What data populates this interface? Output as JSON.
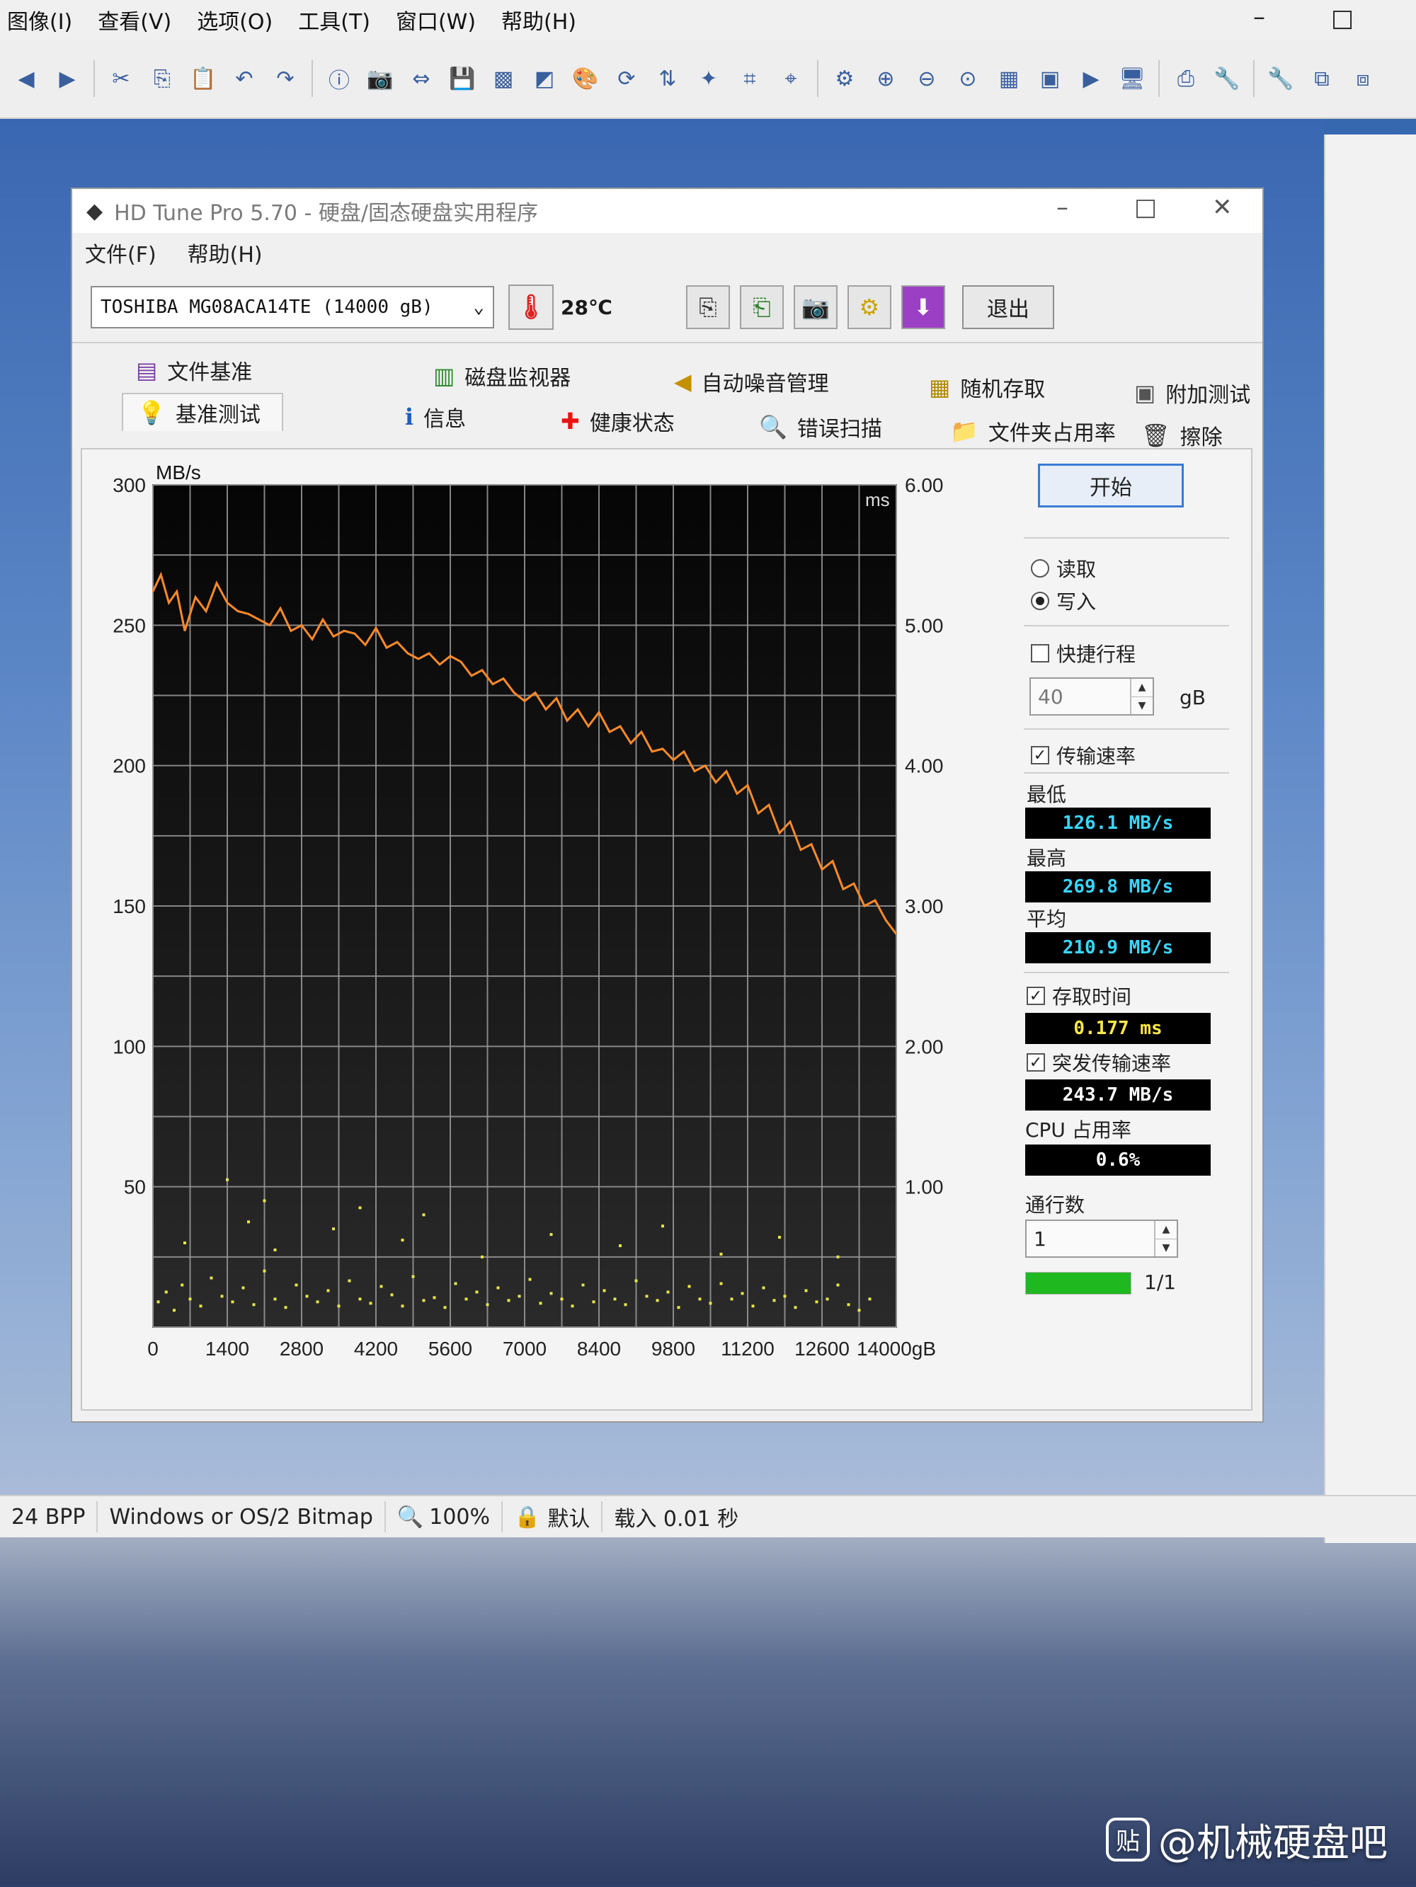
{
  "viewer": {
    "menu": [
      "图像(I)",
      "查看(V)",
      "选项(O)",
      "工具(T)",
      "窗口(W)",
      "帮助(H)"
    ],
    "window_controls": {
      "minimize": "–",
      "maximize": "□"
    },
    "status": {
      "bpp": "24 BPP",
      "format": "Windows or OS/2 Bitmap",
      "zoom": "100%",
      "profile": "默认",
      "load_time": "载入 0.01 秒"
    },
    "toolbar_icons": [
      "back-icon",
      "forward-icon",
      "cut-icon",
      "copy-icon",
      "paste-icon",
      "undo-icon",
      "redo-icon",
      "info-icon",
      "camera-icon",
      "resize-icon",
      "save-icon",
      "grayscale-icon",
      "color-icon",
      "palette-icon",
      "rotate-icon",
      "flip-icon",
      "effects-icon",
      "crop-icon",
      "crop-select-icon",
      "settings-icon",
      "zoom-in-icon",
      "zoom-out-icon",
      "zoom-fit-icon",
      "gallery-icon",
      "thumbnail-icon",
      "slideshow-icon",
      "screen-icon",
      "capture-icon",
      "tools-icon",
      "wrench-icon",
      "copy-to-icon",
      "move-to-icon"
    ]
  },
  "watermark": "@机械硬盘吧",
  "app": {
    "title": "HD Tune Pro 5.70 - 硬盘/固态硬盘实用程序",
    "menu": [
      "文件(F)",
      "帮助(H)"
    ],
    "window_controls": {
      "minimize": "–",
      "maximize": "□",
      "close": "✕"
    },
    "drive": "TOSHIBA MG08ACA14TE (14000 gB)",
    "temperature": "28℃",
    "exit_label": "退出",
    "tabs_row1": [
      "文件基准",
      "磁盘监视器",
      "自动噪音管理",
      "随机存取",
      "附加测试"
    ],
    "tabs_row2": [
      "基准测试",
      "信息",
      "健康状态",
      "错误扫描",
      "文件夹占用率",
      "擦除"
    ]
  },
  "controls": {
    "start": "开始",
    "read": "读取",
    "write": "写入",
    "mode_selected": "write",
    "short_stroke": {
      "label": "快捷行程",
      "checked": false,
      "value": "40",
      "unit": "gB"
    },
    "transfer_rate": {
      "label": "传输速率",
      "checked": true
    },
    "min": {
      "label": "最低",
      "value": "126.1 MB/s"
    },
    "max": {
      "label": "最高",
      "value": "269.8 MB/s"
    },
    "avg": {
      "label": "平均",
      "value": "210.9 MB/s"
    },
    "access_time": {
      "label": "存取时间",
      "checked": true,
      "value": "0.177 ms"
    },
    "burst_rate": {
      "label": "突发传输速率",
      "checked": true,
      "value": "243.7 MB/s"
    },
    "cpu": {
      "label": "CPU 占用率",
      "value": "0.6%"
    },
    "passes": {
      "label": "通行数",
      "value": "1"
    },
    "progress": {
      "fraction": 1.0,
      "text": "1/1"
    }
  },
  "chart_data": {
    "type": "line",
    "left_unit": "MB/s",
    "right_unit": "ms",
    "x_unit": "gB",
    "xlim": [
      0,
      14000
    ],
    "ylim_left": [
      0,
      300
    ],
    "ylim_right": [
      0,
      6
    ],
    "x_ticks": [
      "0",
      "1400",
      "2800",
      "4200",
      "5600",
      "7000",
      "8400",
      "9800",
      "11200",
      "12600",
      "14000gB"
    ],
    "y_ticks_left": [
      "50",
      "100",
      "150",
      "200",
      "250",
      "300"
    ],
    "y_ticks_right": [
      "1.00",
      "2.00",
      "3.00",
      "4.00",
      "5.00",
      "6.00"
    ],
    "grid": true,
    "colors": {
      "transfer": "#ff8a2a",
      "access": "#e6e64a",
      "background": "#0d0d0d",
      "grid": "#9a9a9a"
    },
    "series": [
      {
        "type": "line",
        "x": [
          0,
          150,
          300,
          450,
          600,
          800,
          1000,
          1200,
          1400,
          1600,
          1800,
          2000,
          2200,
          2400,
          2600,
          2800,
          3000,
          3200,
          3400,
          3600,
          3800,
          4000,
          4200,
          4400,
          4600,
          4800,
          5000,
          5200,
          5400,
          5600,
          5800,
          6000,
          6200,
          6400,
          6600,
          6800,
          7000,
          7200,
          7400,
          7600,
          7800,
          8000,
          8200,
          8400,
          8600,
          8800,
          9000,
          9200,
          9400,
          9600,
          9800,
          10000,
          10200,
          10400,
          10600,
          10800,
          11000,
          11200,
          11400,
          11600,
          11800,
          12000,
          12200,
          12400,
          12600,
          12800,
          13000,
          13200,
          13400,
          13600,
          13800,
          14000
        ],
        "y": [
          262,
          268,
          258,
          262,
          248,
          260,
          255,
          265,
          258,
          255,
          254,
          252,
          250,
          256,
          248,
          250,
          245,
          252,
          246,
          248,
          247,
          243,
          249,
          242,
          244,
          240,
          238,
          240,
          236,
          239,
          237,
          232,
          234,
          229,
          231,
          226,
          223,
          226,
          220,
          224,
          216,
          220,
          214,
          219,
          212,
          214,
          208,
          212,
          205,
          206,
          202,
          205,
          198,
          200,
          194,
          198,
          190,
          193,
          183,
          186,
          176,
          180,
          170,
          172,
          163,
          166,
          156,
          158,
          150,
          152,
          145,
          140
        ]
      },
      {
        "type": "scatter",
        "description_marker": "access-time",
        "x": [
          100,
          250,
          400,
          550,
          700,
          900,
          1100,
          1300,
          1500,
          1700,
          1900,
          2100,
          2300,
          2500,
          2700,
          2900,
          3100,
          3300,
          3500,
          3700,
          3900,
          4100,
          4300,
          4500,
          4700,
          4900,
          5100,
          5300,
          5500,
          5700,
          5900,
          6100,
          6300,
          6500,
          6700,
          6900,
          7100,
          7300,
          7500,
          7700,
          7900,
          8100,
          8300,
          8500,
          8700,
          8900,
          9100,
          9300,
          9500,
          9700,
          9900,
          10100,
          10300,
          10500,
          10700,
          10900,
          11100,
          11300,
          11500,
          11700,
          11900,
          12100,
          12300,
          12500,
          12700,
          12900,
          13100,
          13300,
          13500,
          600,
          1800,
          2300,
          3400,
          4700,
          5100,
          6200,
          7500,
          8800,
          9600,
          10700,
          11800,
          12900,
          1400,
          2100,
          3900
        ],
        "y": [
          0.18,
          0.25,
          0.12,
          0.3,
          0.2,
          0.15,
          0.35,
          0.22,
          0.18,
          0.28,
          0.16,
          0.4,
          0.2,
          0.14,
          0.3,
          0.22,
          0.18,
          0.26,
          0.15,
          0.33,
          0.2,
          0.17,
          0.29,
          0.23,
          0.15,
          0.36,
          0.19,
          0.21,
          0.14,
          0.31,
          0.2,
          0.25,
          0.16,
          0.28,
          0.19,
          0.22,
          0.34,
          0.17,
          0.24,
          0.2,
          0.15,
          0.3,
          0.18,
          0.26,
          0.2,
          0.16,
          0.33,
          0.22,
          0.19,
          0.25,
          0.14,
          0.29,
          0.2,
          0.17,
          0.31,
          0.2,
          0.24,
          0.15,
          0.28,
          0.19,
          0.22,
          0.14,
          0.26,
          0.18,
          0.2,
          0.3,
          0.16,
          0.12,
          0.2,
          0.6,
          0.75,
          0.55,
          0.7,
          0.62,
          0.8,
          0.5,
          0.66,
          0.58,
          0.72,
          0.52,
          0.64,
          0.5,
          1.05,
          0.9,
          0.85
        ]
      }
    ]
  }
}
